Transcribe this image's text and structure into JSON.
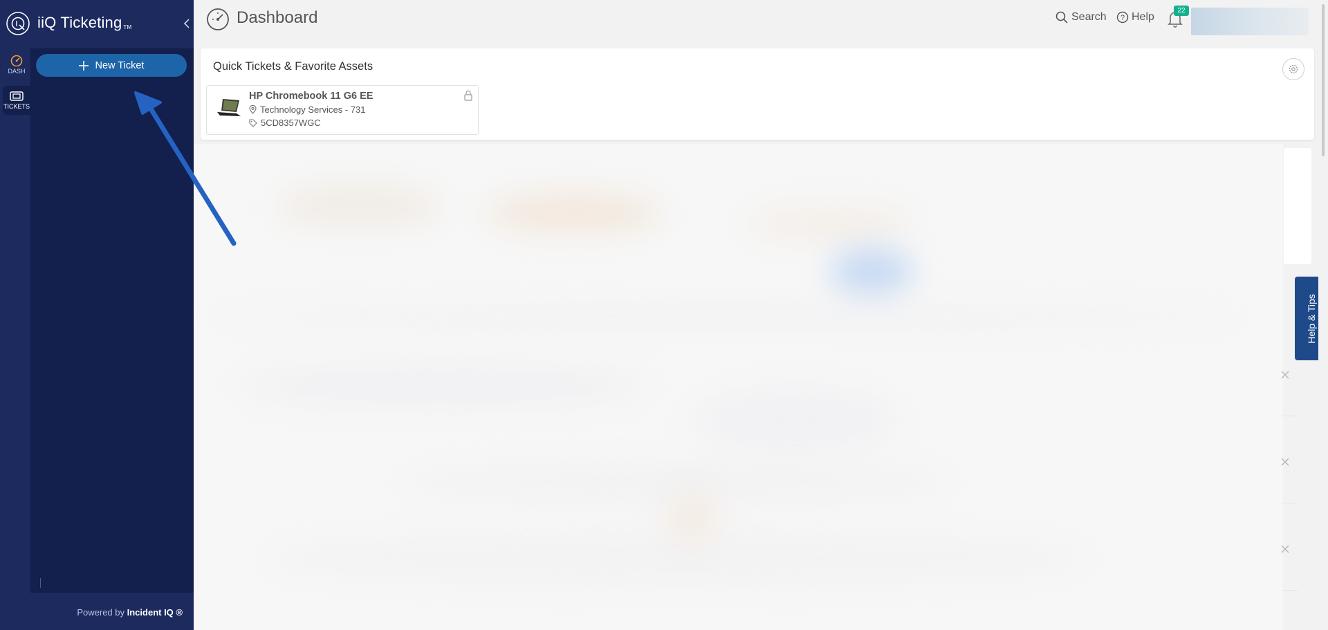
{
  "app": {
    "brand_name": "iiQ Ticketing",
    "brand_tm": "TM",
    "powered_prefix": "Powered by",
    "powered_brand": "Incident IQ ®"
  },
  "rail": {
    "items": [
      {
        "label": "DASH",
        "icon": "dashboard-gauge-icon",
        "color": "#f39c3c"
      },
      {
        "label": "TICKETS",
        "icon": "ticket-icon",
        "active": true
      }
    ]
  },
  "sidebar": {
    "new_ticket_label": "New Ticket"
  },
  "header": {
    "title": "Dashboard",
    "search_label": "Search",
    "help_label": "Help",
    "notification_count": "22"
  },
  "quick_tickets": {
    "title": "Quick Tickets & Favorite Assets",
    "assets": [
      {
        "name": "HP Chromebook 11 G6 EE",
        "location": "Technology Services - 731",
        "tag": "5CD8357WGC",
        "icon": "laptop-icon"
      }
    ]
  },
  "help_tips_label": "Help & Tips",
  "colors": {
    "sidebar": "#1c2a5e",
    "panel": "#131f4c",
    "primary_button": "#1e64a8",
    "badge": "#16b08f",
    "help_tab": "#1f4a8a",
    "arrow": "#2463c2"
  }
}
